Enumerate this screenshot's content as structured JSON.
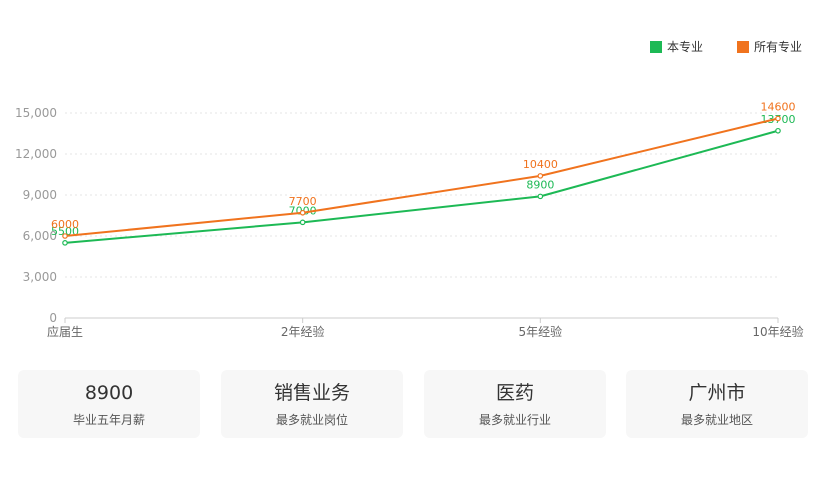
{
  "chart_data": {
    "type": "line",
    "categories": [
      "应届生",
      "2年经验",
      "5年经验",
      "10年经验"
    ],
    "series": [
      {
        "name": "本专业",
        "values": [
          5500,
          7000,
          8900,
          13700
        ],
        "color": "#1db955"
      },
      {
        "name": "所有专业",
        "values": [
          6000,
          7700,
          10400,
          14600
        ],
        "color": "#f0731e"
      }
    ],
    "ylim": [
      0,
      15000
    ],
    "yticks": [
      0,
      3000,
      6000,
      9000,
      12000,
      15000
    ],
    "ytick_labels": [
      "0",
      "3,000",
      "6,000",
      "9,000",
      "12,000",
      "15,000"
    ],
    "grid": true,
    "legend_position": "top-right",
    "title": "",
    "xlabel": "",
    "ylabel": ""
  },
  "cards": [
    {
      "value": "8900",
      "label": "毕业五年月薪"
    },
    {
      "value": "销售业务",
      "label": "最多就业岗位"
    },
    {
      "value": "医药",
      "label": "最多就业行业"
    },
    {
      "value": "广州市",
      "label": "最多就业地区"
    }
  ]
}
